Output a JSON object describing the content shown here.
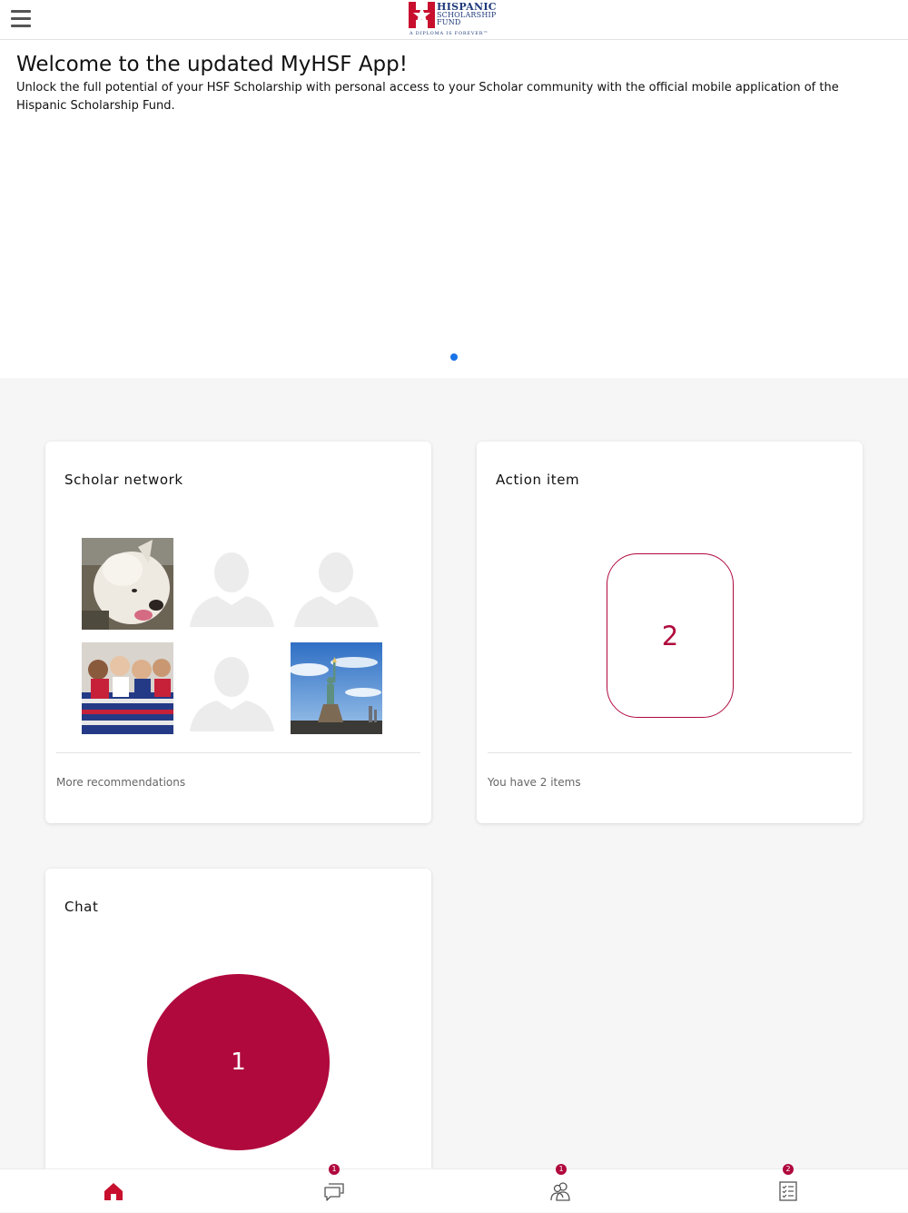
{
  "header": {
    "menu_icon": "hamburger-menu-icon",
    "logo": {
      "line1": "HISPANIC",
      "line2": "SCHOLARSHIP",
      "line3": "FUND",
      "tagline": "A DIPLOMA IS FOREVER™"
    }
  },
  "hero": {
    "title": "Welcome to the updated MyHSF App!",
    "description": "Unlock the full potential of your HSF Scholarship with personal access to your Scholar community with the official mobile application of the Hispanic Scholarship Fund."
  },
  "cards": {
    "scholar_network": {
      "title": "Scholar network",
      "footer": "More recommendations"
    },
    "action_item": {
      "title": "Action item",
      "count": "2",
      "footer": "You have 2 items"
    },
    "chat": {
      "title": "Chat",
      "count": "1"
    }
  },
  "tabbar": {
    "items": [
      {
        "icon": "home-icon",
        "badge": ""
      },
      {
        "icon": "chat-bubbles-icon",
        "badge": "1"
      },
      {
        "icon": "people-icon",
        "badge": "1"
      },
      {
        "icon": "checklist-icon",
        "badge": "2"
      }
    ]
  },
  "colors": {
    "brand_crimson": "#b0093d",
    "pager_blue": "#1a73e8",
    "logo_navy": "#1e3a7a"
  }
}
